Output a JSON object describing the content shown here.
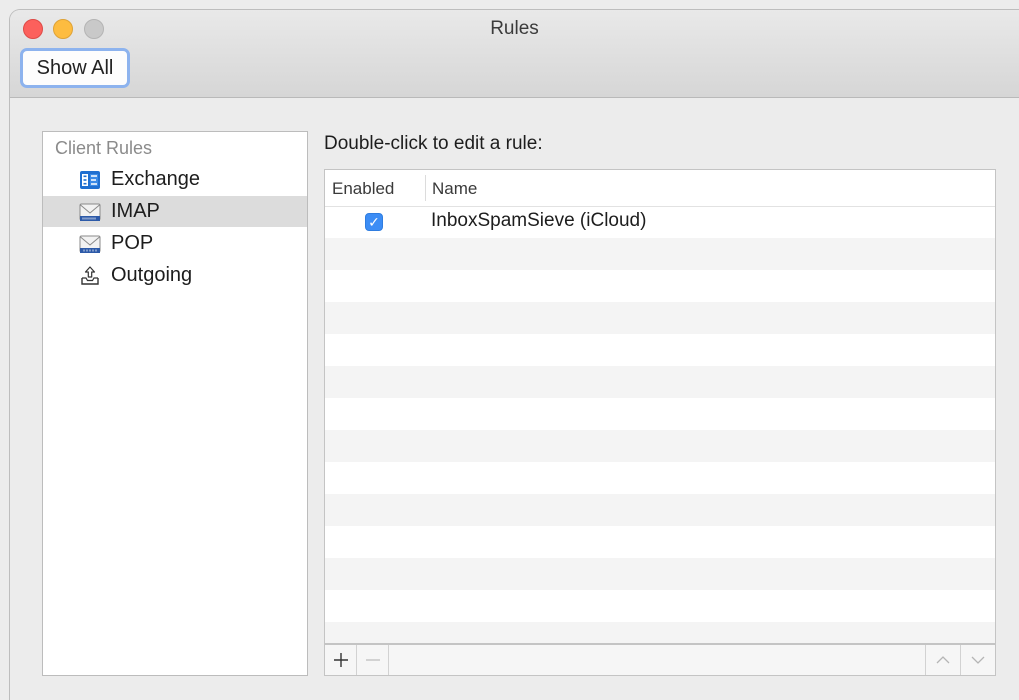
{
  "window": {
    "title": "Rules",
    "show_all_label": "Show All"
  },
  "sidebar": {
    "header": "Client Rules",
    "selected_index": 1,
    "items": [
      {
        "label": "Exchange",
        "icon": "exchange-icon"
      },
      {
        "label": "IMAP",
        "icon": "imap-mail-icon"
      },
      {
        "label": "POP",
        "icon": "pop-mail-icon"
      },
      {
        "label": "Outgoing",
        "icon": "outgoing-icon"
      }
    ]
  },
  "main": {
    "instruction": "Double-click to edit a rule:",
    "columns": {
      "enabled": "Enabled",
      "name": "Name"
    },
    "rules": [
      {
        "enabled": true,
        "name": "InboxSpamSieve (iCloud)"
      }
    ]
  },
  "toolbar": {
    "add_icon": "plus-icon",
    "remove_icon": "minus-icon",
    "move_up_icon": "chevron-up-icon",
    "move_down_icon": "chevron-down-icon"
  },
  "colors": {
    "accent": "#3c8df5",
    "selection": "#dcdcdc",
    "close": "#fc605c",
    "minimize": "#fdbc40",
    "zoom_disabled": "#c9c9c9"
  }
}
